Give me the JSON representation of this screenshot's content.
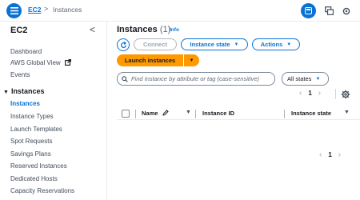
{
  "topbar": {
    "breadcrumb": [
      "EC2",
      "Instances"
    ],
    "separator": ">"
  },
  "sidebar": {
    "title": "EC2",
    "collapse_glyph": "<",
    "items_top": [
      "Dashboard",
      "AWS Global View",
      "Events"
    ],
    "section_title": "Instances",
    "section_items": [
      "Instances",
      "Instance Types",
      "Launch Templates",
      "Spot Requests",
      "Savings Plans",
      "Reserved Instances",
      "Dedicated Hosts",
      "Capacity Reservations"
    ],
    "active_item": "Instances"
  },
  "main": {
    "title": "Instances",
    "count": "(1)",
    "info": "Info",
    "buttons": {
      "connect": "Connect",
      "instance_state": "Instance state",
      "actions": "Actions",
      "launch": "Launch instances"
    },
    "search": {
      "placeholder": "Find Instance by attribute or tag (case-sensitive)"
    },
    "state_filter": "All states",
    "pagination": {
      "page": "1"
    },
    "table": {
      "columns": [
        "Name",
        "Instance ID",
        "Instance state"
      ]
    }
  },
  "colors": {
    "accent": "#0972d3",
    "launch": "#ff9900"
  }
}
